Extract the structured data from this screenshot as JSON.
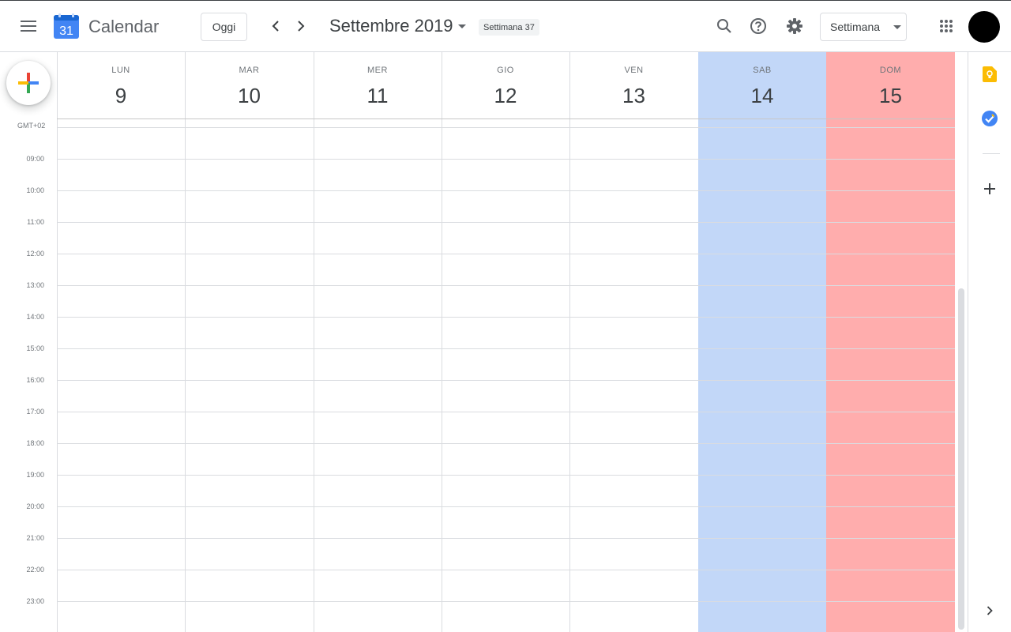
{
  "header": {
    "app_title": "Calendar",
    "logo_day": "31",
    "today_label": "Oggi",
    "period_label": "Settembre 2019",
    "week_chip": "Settimana 37",
    "view_label": "Settimana"
  },
  "timezone_label": "GMT+02",
  "days": [
    {
      "dow": "LUN",
      "num": "9"
    },
    {
      "dow": "MAR",
      "num": "10"
    },
    {
      "dow": "MER",
      "num": "11"
    },
    {
      "dow": "GIO",
      "num": "12"
    },
    {
      "dow": "VEN",
      "num": "13"
    },
    {
      "dow": "SAB",
      "num": "14"
    },
    {
      "dow": "DOM",
      "num": "15"
    }
  ],
  "hours": [
    "09:00",
    "10:00",
    "11:00",
    "12:00",
    "13:00",
    "14:00",
    "15:00",
    "16:00",
    "17:00",
    "18:00",
    "19:00",
    "20:00",
    "21:00",
    "22:00",
    "23:00"
  ],
  "colors": {
    "saturday_bg": "#c2d7f8",
    "sunday_bg": "#ffadad",
    "keep": "#fbbc04",
    "tasks": "#4285f4"
  },
  "icons": [
    "menu-icon",
    "calendar-logo-icon",
    "chevron-left-icon",
    "chevron-right-icon",
    "caret-down-icon",
    "search-icon",
    "help-icon",
    "gear-icon",
    "apps-grid-icon",
    "keep-icon",
    "tasks-icon",
    "add-icon",
    "chevron-right-icon"
  ]
}
